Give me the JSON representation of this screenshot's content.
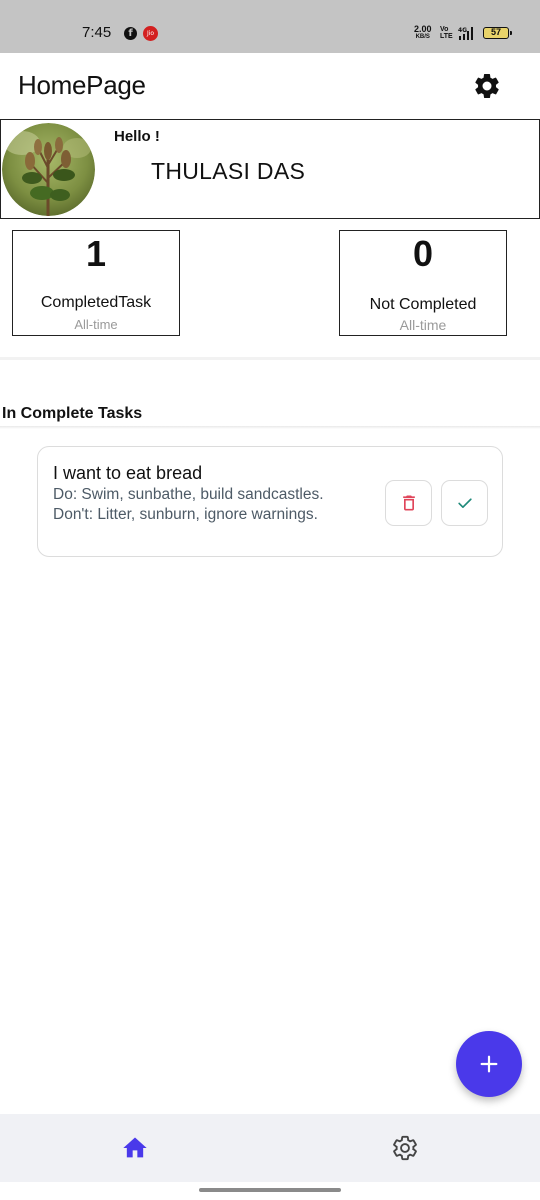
{
  "status_bar": {
    "time": "7:45",
    "net_speed": "2.00",
    "net_unit": "KB/S",
    "volte_top": "Vo",
    "volte_bottom": "LTE",
    "network": "4G",
    "battery": "57",
    "icons": [
      "facebook-icon",
      "jio-icon",
      "signal-icon",
      "battery-icon"
    ]
  },
  "app_bar": {
    "title": "HomePage",
    "settings_icon": "gear-icon"
  },
  "profile": {
    "greeting": "Hello !",
    "name": "THULASI DAS"
  },
  "stats": [
    {
      "value": "1",
      "label": "CompletedTask",
      "sub": "All-time"
    },
    {
      "value": "0",
      "label": "Not Completed",
      "sub": "All-time"
    }
  ],
  "section": {
    "title": "In Complete Tasks"
  },
  "tasks": [
    {
      "title": "I want to eat bread",
      "do": "Do: Swim, sunbathe, build sandcastles.",
      "dont": "Don't: Litter, sunburn, ignore warnings.",
      "delete_icon": "trash-icon",
      "complete_icon": "check-icon"
    }
  ],
  "fab": {
    "icon": "plus-icon"
  },
  "bottom_nav": {
    "items": [
      {
        "icon": "home-icon",
        "active": true
      },
      {
        "icon": "gear-icon",
        "active": false
      }
    ]
  },
  "colors": {
    "accent": "#4a39ea",
    "delete": "#e0455a",
    "complete": "#1f8a7a",
    "status_bar": "#c4c4c4",
    "nav_bg": "#f0f1f5"
  }
}
